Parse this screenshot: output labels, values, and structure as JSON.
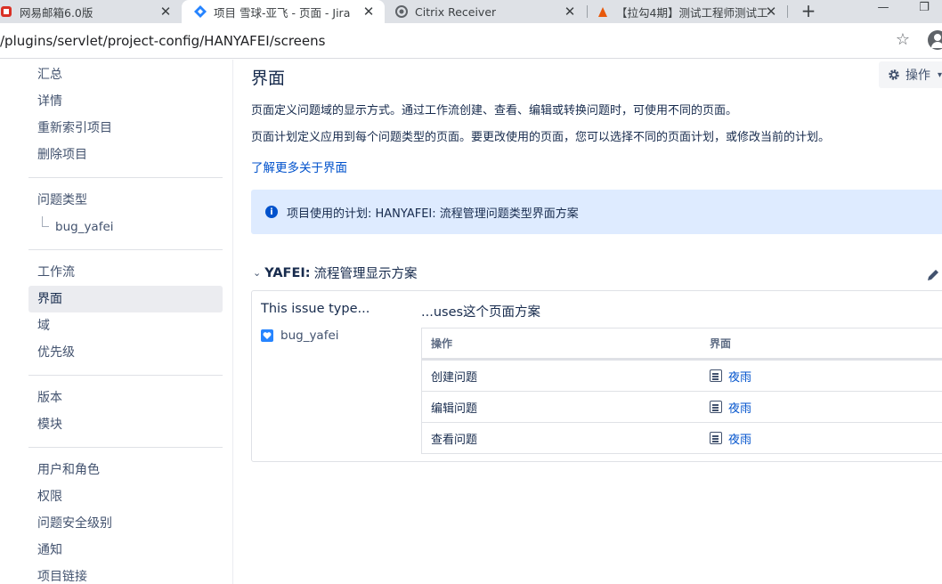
{
  "browser": {
    "tabs": [
      {
        "title": "网易邮箱6.0版",
        "close": "✕"
      },
      {
        "title": "项目 雪球-亚飞 - 页面 - Jira",
        "close": "✕"
      },
      {
        "title": "Citrix Receiver",
        "close": "✕"
      },
      {
        "title": "【拉勾4期】测试工程师测试工",
        "close": "✕"
      }
    ],
    "new_tab": "+",
    "minimize": "—",
    "restore": "❐",
    "url": "/plugins/servlet/project-config/HANYAFEI/screens"
  },
  "sidebar": {
    "group1": [
      "汇总",
      "详情",
      "重新索引项目",
      "删除项目"
    ],
    "issue_types_label": "问题类型",
    "issue_type_child": "bug_yafei",
    "group3": [
      "工作流",
      "界面",
      "域",
      "优先级"
    ],
    "group4": [
      "版本",
      "模块"
    ],
    "group5": [
      "用户和角色",
      "权限",
      "问题安全级别",
      "通知",
      "项目链接"
    ]
  },
  "main": {
    "title": "界面",
    "actions_label": "操作",
    "desc1": "页面定义问题域的显示方式。通过工作流创建、查看、编辑或转换问题时，可使用不同的页面。",
    "desc2": "页面计划定义应用到每个问题类型的页面。要更改使用的页面，您可以选择不同的页面计划，或修改当前的计划。",
    "learn_more": "了解更多关于界面",
    "info": "项目使用的计划: HANYAFEI: 流程管理问题类型界面方案",
    "scheme_prefix": "YAFEI:",
    "scheme_name": "流程管理显示方案",
    "issue_type_head": "This issue type...",
    "uses_head": "...uses这个页面方案",
    "issue_type": "bug_yafei",
    "table": {
      "col_op": "操作",
      "col_screen": "界面",
      "rows": [
        {
          "op": "创建问题",
          "screen": "夜雨"
        },
        {
          "op": "编辑问题",
          "screen": "夜雨"
        },
        {
          "op": "查看问题",
          "screen": "夜雨"
        }
      ]
    }
  }
}
